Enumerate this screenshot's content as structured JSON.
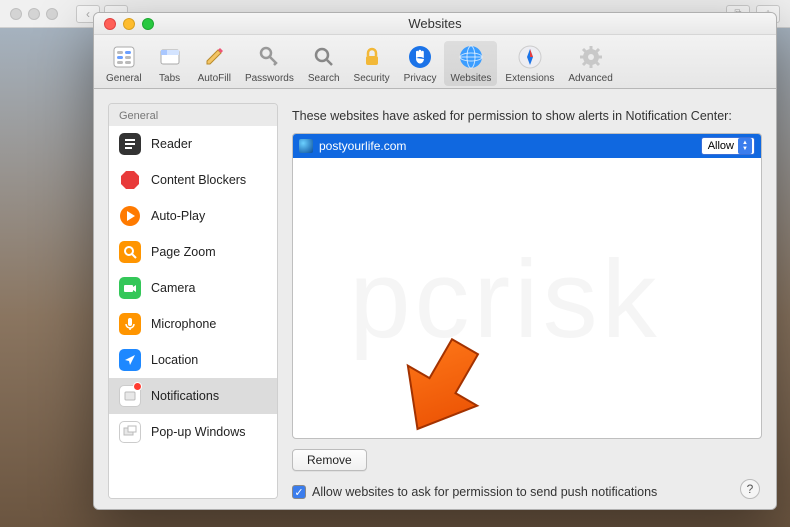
{
  "window": {
    "title": "Websites"
  },
  "toolbar": {
    "items": [
      {
        "label": "General"
      },
      {
        "label": "Tabs"
      },
      {
        "label": "AutoFill"
      },
      {
        "label": "Passwords"
      },
      {
        "label": "Search"
      },
      {
        "label": "Security"
      },
      {
        "label": "Privacy"
      },
      {
        "label": "Websites"
      },
      {
        "label": "Extensions"
      },
      {
        "label": "Advanced"
      }
    ]
  },
  "sidebar": {
    "header": "General",
    "items": [
      {
        "label": "Reader"
      },
      {
        "label": "Content Blockers"
      },
      {
        "label": "Auto-Play"
      },
      {
        "label": "Page Zoom"
      },
      {
        "label": "Camera"
      },
      {
        "label": "Microphone"
      },
      {
        "label": "Location"
      },
      {
        "label": "Notifications"
      },
      {
        "label": "Pop-up Windows"
      }
    ]
  },
  "main": {
    "description": "These websites have asked for permission to show alerts in Notification Center:",
    "sites": [
      {
        "name": "postyourlife.com",
        "permission": "Allow"
      }
    ],
    "remove_label": "Remove",
    "checkbox_label": "Allow websites to ask for permission to send push notifications"
  },
  "help": "?"
}
